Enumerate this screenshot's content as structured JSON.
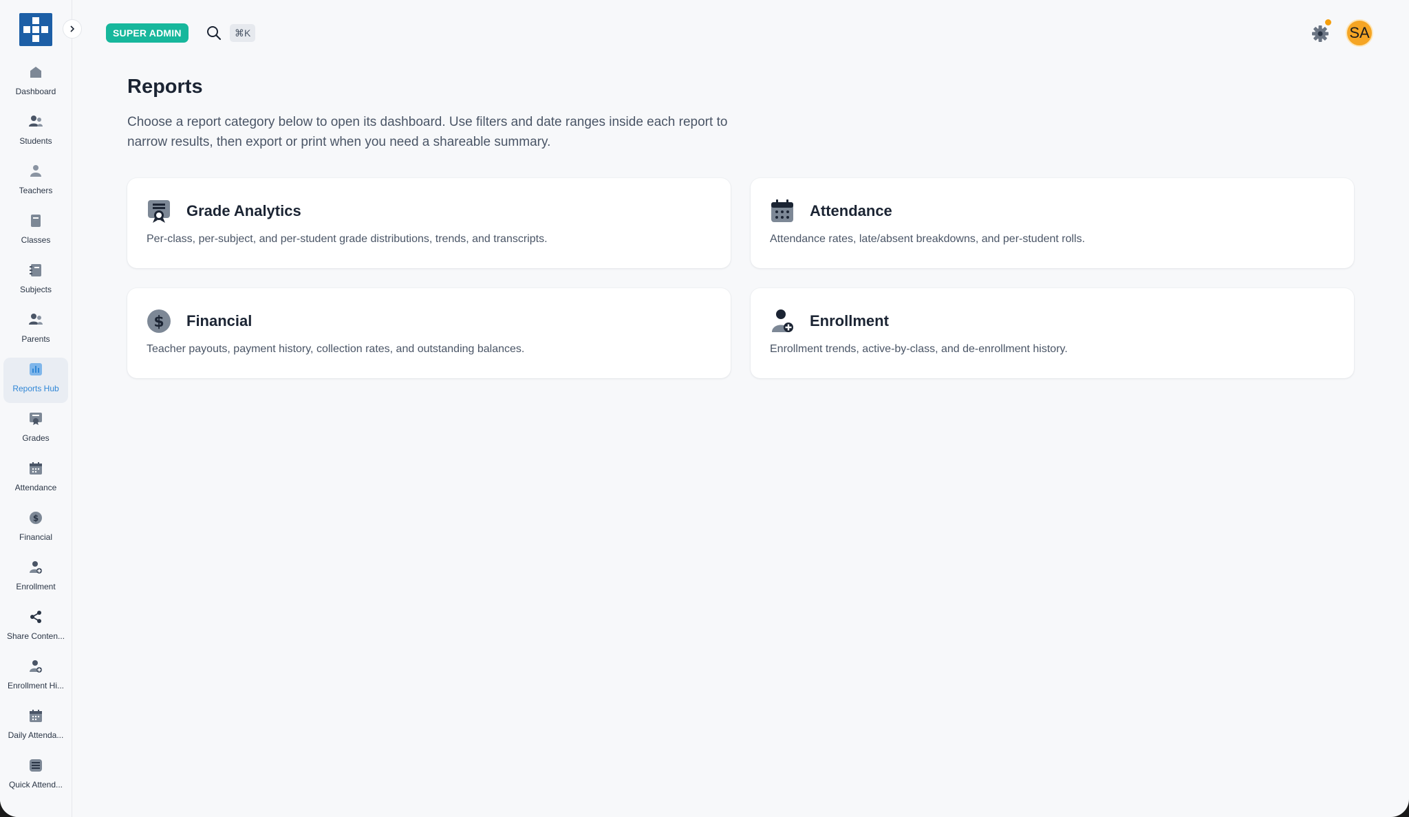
{
  "sidebar": {
    "items": [
      {
        "label": "Dashboard",
        "icon": "home-icon"
      },
      {
        "label": "Students",
        "icon": "users-icon"
      },
      {
        "label": "Teachers",
        "icon": "user-icon"
      },
      {
        "label": "Classes",
        "icon": "book-icon"
      },
      {
        "label": "Subjects",
        "icon": "notebook-icon"
      },
      {
        "label": "Parents",
        "icon": "users-icon"
      },
      {
        "label": "Reports Hub",
        "icon": "chart-icon",
        "active": true
      },
      {
        "label": "Grades",
        "icon": "certificate-icon"
      },
      {
        "label": "Attendance",
        "icon": "calendar-icon"
      },
      {
        "label": "Financial",
        "icon": "dollar-icon"
      },
      {
        "label": "Enrollment",
        "icon": "user-plus-icon"
      },
      {
        "label": "Share Conten...",
        "icon": "share-icon"
      },
      {
        "label": "Enrollment Hi...",
        "icon": "user-plus-icon"
      },
      {
        "label": "Daily Attenda...",
        "icon": "calendar-icon"
      },
      {
        "label": "Quick Attend...",
        "icon": "checklist-icon"
      }
    ]
  },
  "topbar": {
    "role_badge": "SUPER ADMIN",
    "shortcut": "⌘K",
    "avatar_initials": "SA"
  },
  "main": {
    "title": "Reports",
    "description": "Choose a report category below to open its dashboard. Use filters and date ranges inside each report to narrow results, then export or print when you need a shareable summary.",
    "cards": [
      {
        "title": "Grade Analytics",
        "desc": "Per-class, per-subject, and per-student grade distributions, trends, and transcripts.",
        "icon": "certificate-icon"
      },
      {
        "title": "Attendance",
        "desc": "Attendance rates, late/absent breakdowns, and per-student rolls.",
        "icon": "calendar-icon"
      },
      {
        "title": "Financial",
        "desc": "Teacher payouts, payment history, collection rates, and outstanding balances.",
        "icon": "dollar-icon"
      },
      {
        "title": "Enrollment",
        "desc": "Enrollment trends, active-by-class, and de-enrollment history.",
        "icon": "user-plus-icon"
      }
    ]
  },
  "colors": {
    "accent": "#2f86d6",
    "badge": "#17b79c",
    "logo": "#1d5fa6",
    "avatar": "#f5a524",
    "notification": "#f59e0b"
  }
}
